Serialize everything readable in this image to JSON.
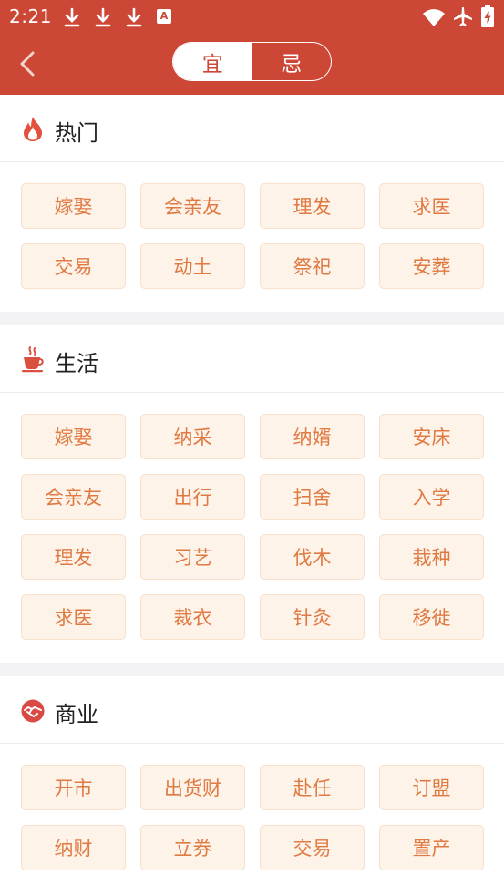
{
  "status_bar": {
    "time": "2:21",
    "icons": [
      "download-icon",
      "download-icon",
      "download-icon",
      "a-icon",
      "wifi-icon",
      "airplane-icon",
      "battery-charging-icon"
    ],
    "a_label": "A"
  },
  "nav": {
    "back_icon": "chevron-left-icon",
    "tabs": [
      {
        "label": "宜",
        "active": true
      },
      {
        "label": "忌",
        "active": false
      }
    ]
  },
  "colors": {
    "header": "#cc4736",
    "tag_bg": "#fdf3e8",
    "tag_text": "#e07a43",
    "divider": "#f3f3f5"
  },
  "sections": {
    "hot": {
      "icon": "fire-icon",
      "title": "热门",
      "tags": [
        "嫁娶",
        "会亲友",
        "理发",
        "求医",
        "交易",
        "动土",
        "祭祀",
        "安葬"
      ]
    },
    "life": {
      "icon": "coffee-cup-icon",
      "title": "生活",
      "tags": [
        "嫁娶",
        "纳采",
        "纳婿",
        "安床",
        "会亲友",
        "出行",
        "扫舍",
        "入学",
        "理发",
        "习艺",
        "伐木",
        "栽种",
        "求医",
        "裁衣",
        "针灸",
        "移徙"
      ]
    },
    "business": {
      "icon": "handshake-icon",
      "title": "商业",
      "tags": [
        "开市",
        "出货财",
        "赴任",
        "订盟",
        "纳财",
        "立券",
        "交易",
        "置产"
      ]
    }
  }
}
